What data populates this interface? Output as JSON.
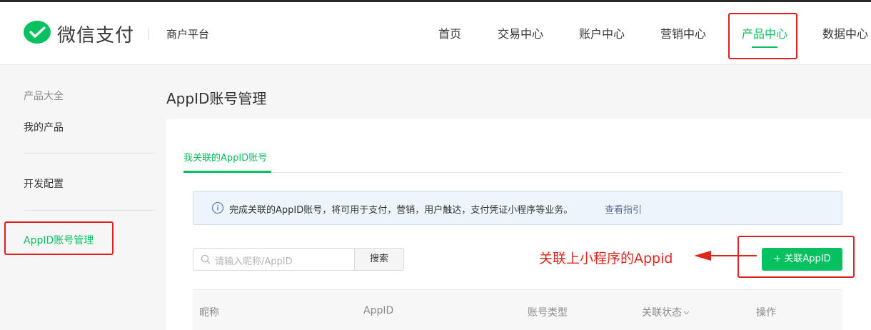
{
  "brand": {
    "name": "微信支付",
    "subtitle": "商户平台",
    "accent_color": "#07c160"
  },
  "nav": {
    "items": [
      {
        "label": "首页"
      },
      {
        "label": "交易中心"
      },
      {
        "label": "账户中心"
      },
      {
        "label": "营销中心"
      },
      {
        "label": "产品中心",
        "active": true
      },
      {
        "label": "数据中心"
      }
    ]
  },
  "sidebar": {
    "items": [
      {
        "label": "产品大全",
        "type": "group"
      },
      {
        "label": "我的产品"
      },
      {
        "label": "开发配置"
      },
      {
        "label": "AppID账号管理",
        "active": true
      }
    ]
  },
  "page": {
    "title": "AppID账号管理"
  },
  "tabs": [
    {
      "label": "我关联的AppID账号",
      "active": true
    }
  ],
  "notice": {
    "icon": "info-icon",
    "text": "完成关联的AppID账号，将可用于支付，营销，用户触达，支付凭证小程序等业务。",
    "link": "查看指引"
  },
  "search": {
    "icon": "search-icon",
    "placeholder": "请输入昵称/AppID",
    "button_label": "搜索"
  },
  "annotation": {
    "text": "关联上小程序的Appid",
    "color": "#e0271e"
  },
  "actions": {
    "add_label": "+ 关联AppID"
  },
  "table": {
    "columns": [
      {
        "label": "昵称"
      },
      {
        "label": "AppID"
      },
      {
        "label": "账号类型"
      },
      {
        "label": "关联状态",
        "sortable": true,
        "icon": "chevron-down-icon"
      },
      {
        "label": "操作"
      }
    ]
  }
}
